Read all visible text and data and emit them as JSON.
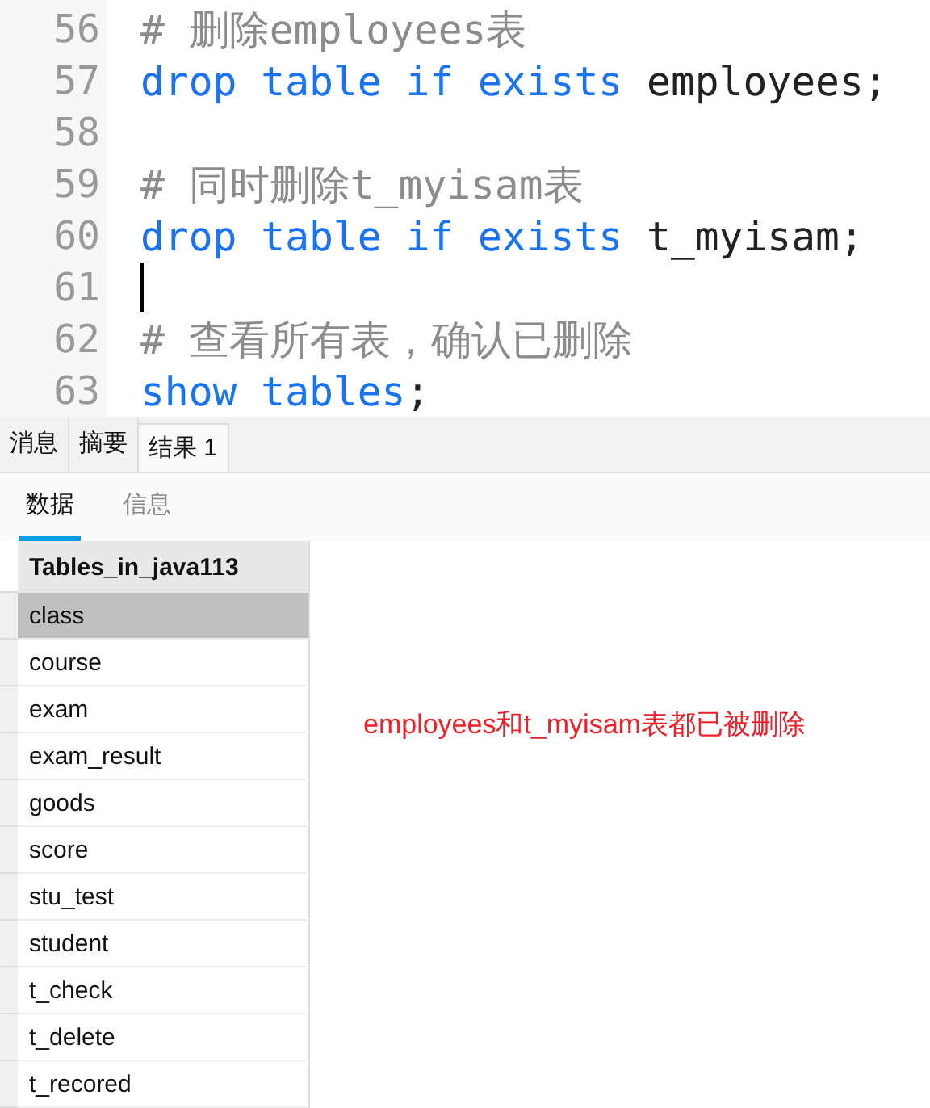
{
  "editor": {
    "lines": [
      {
        "number": "56",
        "caret": false,
        "tokens": [
          {
            "kind": "comment",
            "text": "# 删除employees表"
          }
        ]
      },
      {
        "number": "57",
        "caret": false,
        "tokens": [
          {
            "kind": "keyword",
            "text": "drop table if exists"
          },
          {
            "kind": "plain",
            "text": " employees;"
          }
        ]
      },
      {
        "number": "58",
        "caret": false
      },
      {
        "number": "59",
        "caret": false,
        "tokens": [
          {
            "kind": "comment",
            "text": "# 同时删除t_myisam表"
          }
        ]
      },
      {
        "number": "60",
        "caret": false,
        "tokens": [
          {
            "kind": "keyword",
            "text": "drop table if exists"
          },
          {
            "kind": "plain",
            "text": " t_myisam;"
          }
        ]
      },
      {
        "number": "61",
        "caret": true
      },
      {
        "number": "62",
        "caret": false,
        "tokens": [
          {
            "kind": "comment",
            "text": "# 查看所有表，确认已删除"
          }
        ]
      },
      {
        "number": "63",
        "caret": false,
        "tokens": [
          {
            "kind": "keyword",
            "text": "show tables"
          },
          {
            "kind": "plain",
            "text": ";"
          }
        ]
      }
    ]
  },
  "result_tabs": [
    {
      "label": "消息",
      "selected": false
    },
    {
      "label": "摘要",
      "selected": false
    },
    {
      "label": "结果 1",
      "selected": true
    }
  ],
  "sub_tabs": [
    {
      "label": "数据",
      "selected": true
    },
    {
      "label": "信息",
      "selected": false
    }
  ],
  "table": {
    "columns": [
      "Tables_in_java113"
    ],
    "rows": [
      {
        "cells": [
          "class"
        ],
        "selected": true
      },
      {
        "cells": [
          "course"
        ],
        "selected": false
      },
      {
        "cells": [
          "exam"
        ],
        "selected": false
      },
      {
        "cells": [
          "exam_result"
        ],
        "selected": false
      },
      {
        "cells": [
          "goods"
        ],
        "selected": false
      },
      {
        "cells": [
          "score"
        ],
        "selected": false
      },
      {
        "cells": [
          "stu_test"
        ],
        "selected": false
      },
      {
        "cells": [
          "student"
        ],
        "selected": false
      },
      {
        "cells": [
          "t_check"
        ],
        "selected": false
      },
      {
        "cells": [
          "t_delete"
        ],
        "selected": false
      },
      {
        "cells": [
          "t_recored"
        ],
        "selected": false
      }
    ]
  },
  "annotation": "employees和t_myisam表都已被删除"
}
